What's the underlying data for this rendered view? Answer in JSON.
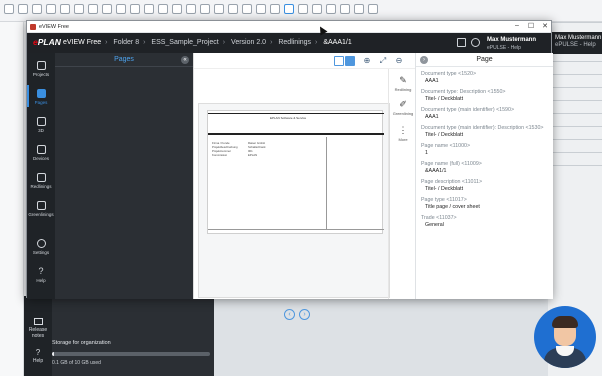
{
  "window": {
    "title": "eVIEW Free",
    "min": "–",
    "max": "☐",
    "close": "✕"
  },
  "header": {
    "logo_e": "e",
    "logo_plan": "PLAN",
    "app": "eVIEW Free",
    "crumbs": [
      "Folder 8",
      "ESS_Sample_Project",
      "Version 2.0",
      "Redlinings",
      "&AAA1/1"
    ],
    "user_name": "Max Mustermann",
    "user_sub": "ePULSE - Help"
  },
  "sidebar": [
    {
      "label": "Projects",
      "icon": "cloud-icon"
    },
    {
      "label": "Pages",
      "icon": "pages-icon",
      "active": true
    },
    {
      "label": "3D",
      "icon": "cube-icon"
    },
    {
      "label": "Devices",
      "icon": "devices-icon"
    },
    {
      "label": "Redlinings",
      "icon": "pen-icon"
    },
    {
      "label": "Greenlinings",
      "icon": "marker-icon"
    },
    {
      "label": "Settings",
      "icon": "gear-icon"
    },
    {
      "label": "Help",
      "icon": "help-icon"
    }
  ],
  "pages_panel": {
    "title": "Pages",
    "collapse": "«"
  },
  "viewer": {
    "right_tools": [
      {
        "label": "Redlining",
        "icon": "pen-icon"
      },
      {
        "label": "Greenlining",
        "icon": "marker-icon"
      },
      {
        "label": "More",
        "icon": "more-icon"
      }
    ]
  },
  "sheet": {
    "company": "EPLAN Software & Service",
    "rows": [
      "Firma / Kunde",
      "Projektbeschreibung",
      "Projektnummer",
      "Kommission"
    ],
    "vals": [
      "Raiser GmbH",
      "Schaltschrank",
      "001",
      "EPLAN"
    ]
  },
  "props": {
    "title": "Page",
    "items": [
      {
        "k": "Document type <1520>",
        "v": "AAA1"
      },
      {
        "k": "Document type: Description <1550>",
        "v": "Titel- / Deckblatt"
      },
      {
        "k": "Document type (main identifier) <1590>",
        "v": "AAA1"
      },
      {
        "k": "Document type (main identifier): Description <1530>",
        "v": "Titel- / Deckblatt"
      },
      {
        "k": "Page name <11000>",
        "v": "1"
      },
      {
        "k": "Page name (full) <11009>",
        "v": "&AAA1/1"
      },
      {
        "k": "Page description <11011>",
        "v": "Titel- / Deckblatt"
      },
      {
        "k": "Page type <11017>",
        "v": "Title page / cover sheet"
      },
      {
        "k": "Trade <11037>",
        "v": "General"
      }
    ]
  },
  "bg_app": {
    "nav": [
      {
        "label": "Release notes"
      },
      {
        "label": "Help"
      }
    ],
    "storage_label": "Storage for organization",
    "storage_value": "0.1 GB of 10 GB used",
    "storage_fraction": 0.01,
    "right_user": "Max Mustermann",
    "right_sub": "ePULSE - Help"
  }
}
